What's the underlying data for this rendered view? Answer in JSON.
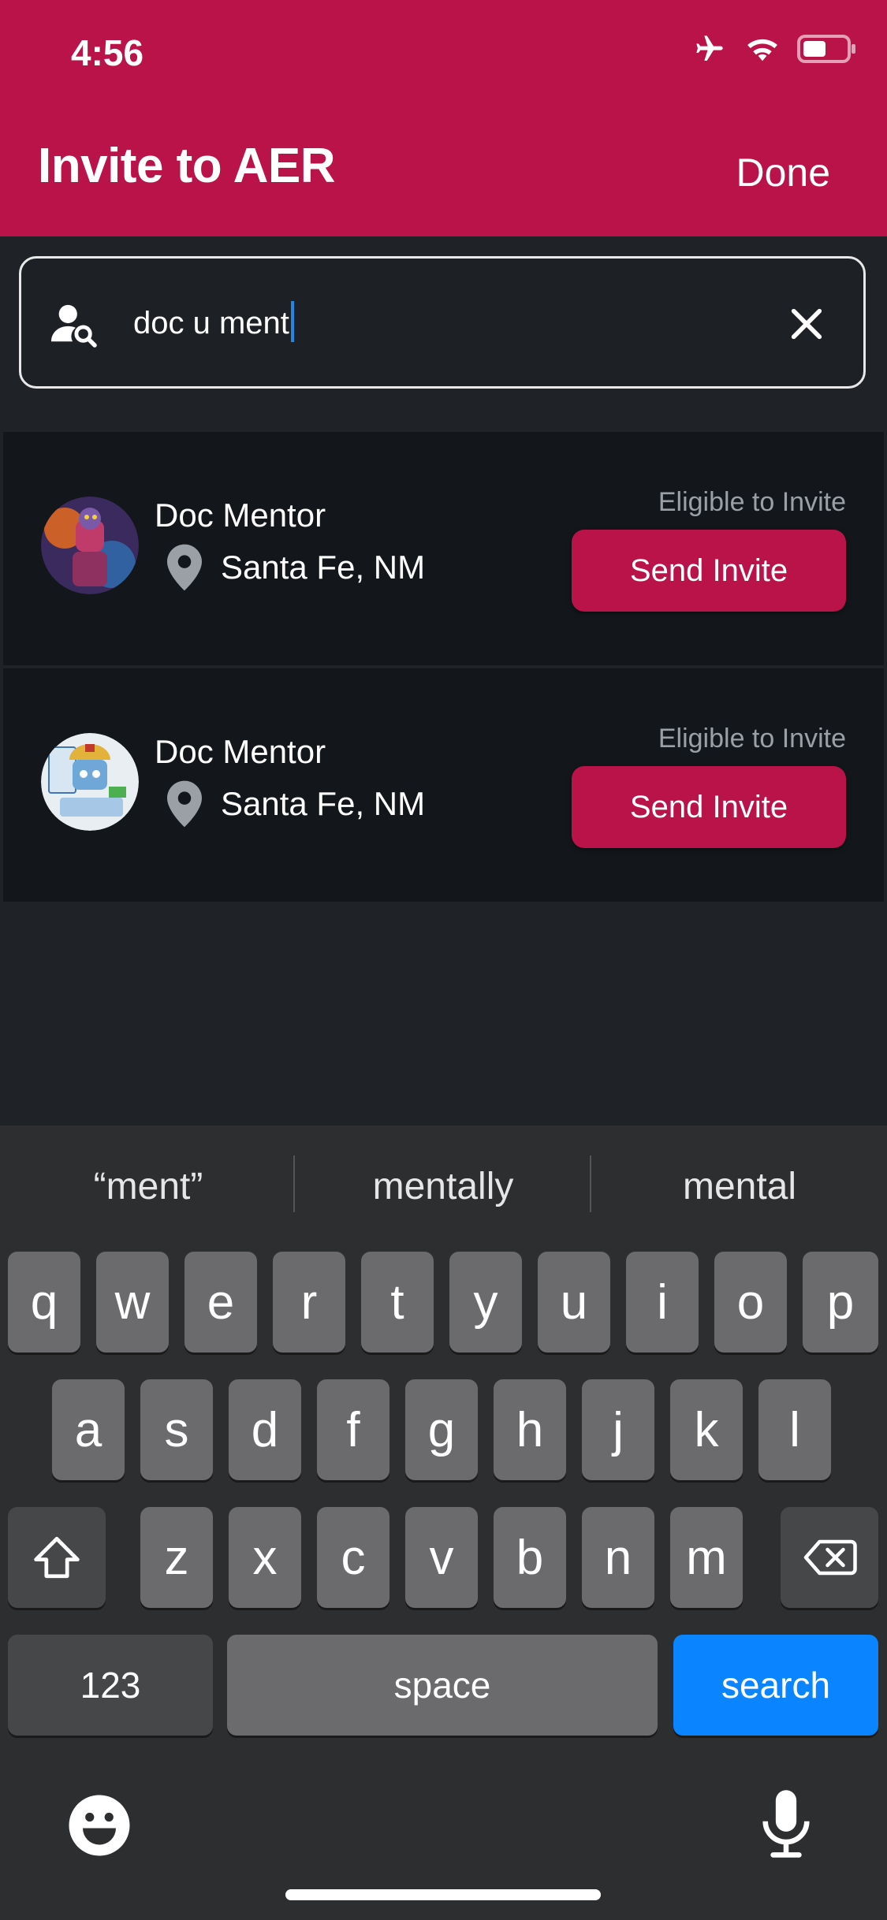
{
  "status": {
    "time": "4:56"
  },
  "header": {
    "title": "Invite to AER",
    "done_label": "Done"
  },
  "search": {
    "value": "doc u ment"
  },
  "results": [
    {
      "name": "Doc Mentor",
      "location": "Santa Fe, NM",
      "eligibility": "Eligible to Invite",
      "button": "Send Invite"
    },
    {
      "name": "Doc Mentor",
      "location": "Santa Fe, NM",
      "eligibility": "Eligible to Invite",
      "button": "Send Invite"
    }
  ],
  "keyboard": {
    "suggestions": [
      "“ment”",
      "mentally",
      "mental"
    ],
    "row1": [
      "q",
      "w",
      "e",
      "r",
      "t",
      "y",
      "u",
      "i",
      "o",
      "p"
    ],
    "row2": [
      "a",
      "s",
      "d",
      "f",
      "g",
      "h",
      "j",
      "k",
      "l"
    ],
    "row3": [
      "z",
      "x",
      "c",
      "v",
      "b",
      "n",
      "m"
    ],
    "numbers_label": "123",
    "space_label": "space",
    "search_label": "search"
  },
  "colors": {
    "brand": "#b9134a",
    "accent_blue": "#0a84ff",
    "background": "#1f2328"
  }
}
